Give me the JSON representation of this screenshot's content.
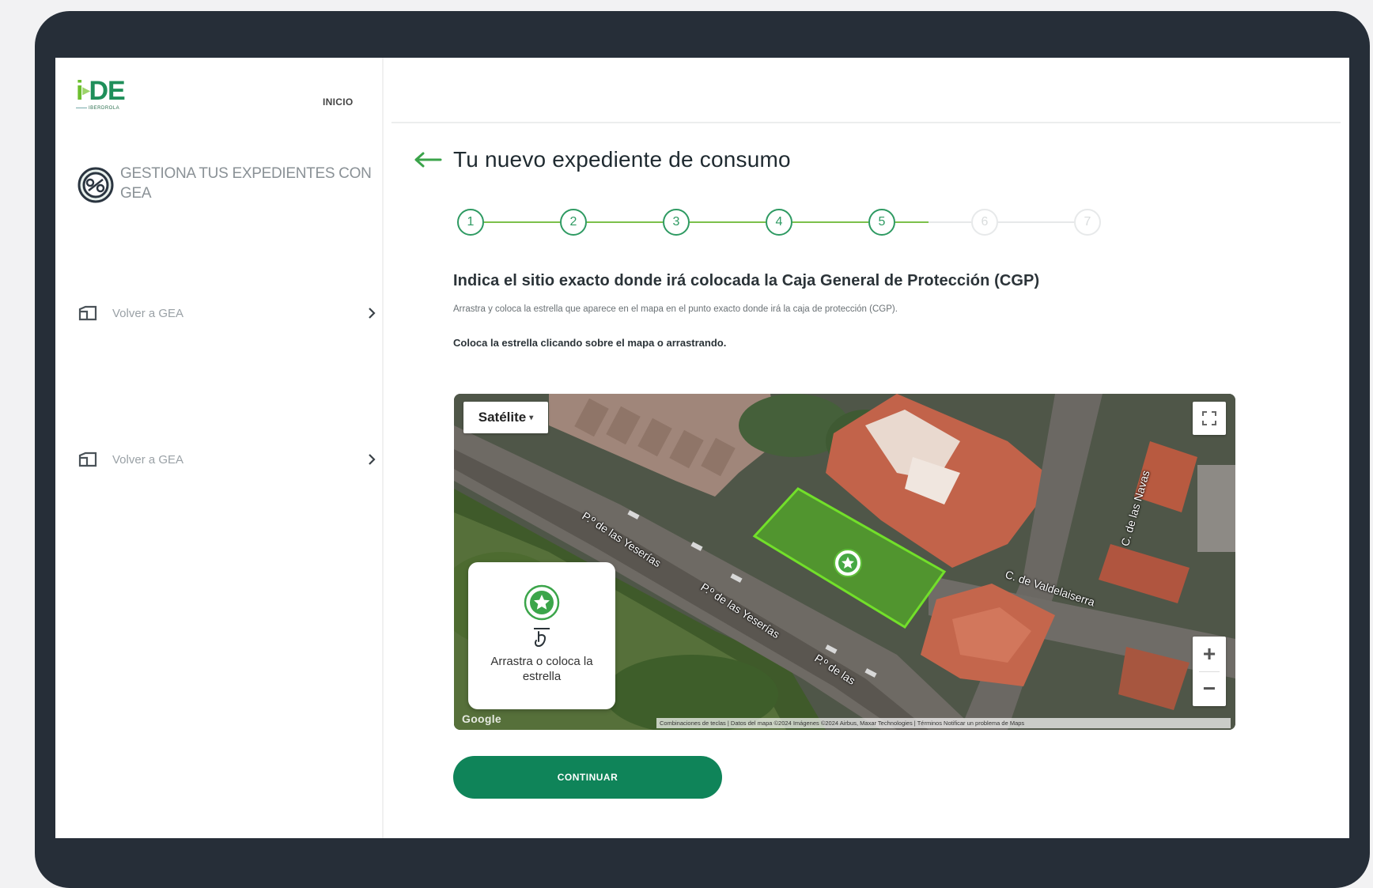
{
  "brand": {
    "logo_main": "i",
    "logo_de": "DE",
    "logo_sub": "IBERDROLA"
  },
  "nav": {
    "inicio": "INICIO"
  },
  "sidebar": {
    "title": "GESTIONA TUS EXPEDIENTES CON GEA",
    "links": [
      {
        "label": "Volver a GEA"
      },
      {
        "label": "Volver a GEA"
      }
    ]
  },
  "page": {
    "title": "Tu nuevo expediente de consumo",
    "section_title": "Indica el sitio exacto donde irá colocada la Caja General de Protección (CGP)",
    "section_desc": "Arrastra y coloca la estrella que aparece en el mapa en el punto exacto donde irá la caja de protección (CGP).",
    "instruction": "Coloca la estrella clicando sobre el mapa o arrastrando."
  },
  "stepper": {
    "steps": [
      "1",
      "2",
      "3",
      "4",
      "5",
      "6",
      "7"
    ],
    "current": 5
  },
  "map": {
    "type_label": "Satélite",
    "zoom_in": "+",
    "zoom_out": "−",
    "card_text": "Arrastra o coloca la estrella",
    "google": "Google",
    "attribution": "Combinaciones de teclas | Datos del mapa ©2024 Imágenes ©2024 Airbus, Maxar Technologies | Términos   Notificar un problema de Maps",
    "streets": {
      "s1": "P.º de las Yeserías",
      "s2": "P.º de las Yeserías",
      "s3": "P.º de las",
      "s4": "C. de Valdelaiserra",
      "s5": "C. de las Navas"
    }
  },
  "actions": {
    "continue": "CONTINUAR"
  },
  "colors": {
    "primary": "#0f8459",
    "accent": "#6cbf2e",
    "frame": "#262e38"
  }
}
